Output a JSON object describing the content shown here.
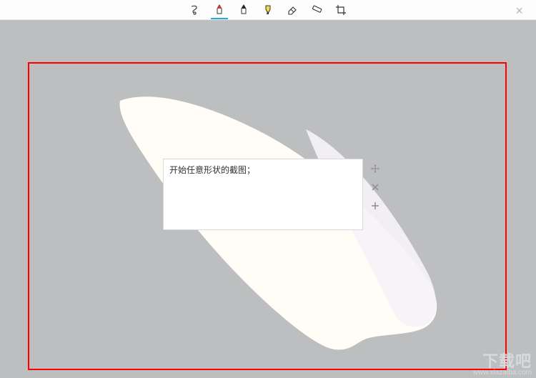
{
  "toolbar": {
    "tools": [
      {
        "name": "freeform-snip-icon",
        "active": false
      },
      {
        "name": "pen-red-icon",
        "active": true
      },
      {
        "name": "pen-black-icon",
        "active": false
      },
      {
        "name": "highlighter-icon",
        "active": false
      },
      {
        "name": "eraser-icon",
        "active": false
      },
      {
        "name": "ruler-icon",
        "active": false
      },
      {
        "name": "crop-icon",
        "active": false
      }
    ],
    "close_title": "关闭"
  },
  "annotation": {
    "text": "开始任意形状的截图；",
    "handles": {
      "move_title": "移动",
      "delete_title": "删除",
      "add_title": "添加"
    }
  },
  "watermark": {
    "text": "下载吧",
    "sub": "www.xiazaiba.com"
  }
}
